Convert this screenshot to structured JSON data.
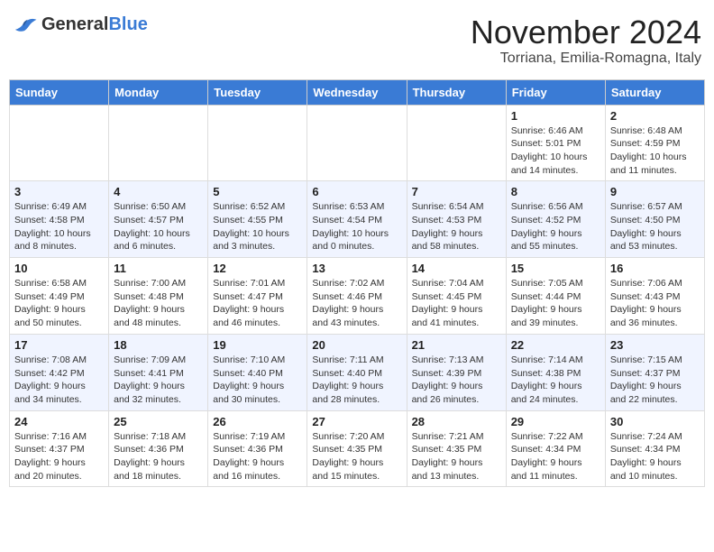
{
  "header": {
    "logo_general": "General",
    "logo_blue": "Blue",
    "month": "November 2024",
    "location": "Torriana, Emilia-Romagna, Italy"
  },
  "days_of_week": [
    "Sunday",
    "Monday",
    "Tuesday",
    "Wednesday",
    "Thursday",
    "Friday",
    "Saturday"
  ],
  "weeks": [
    {
      "alt": false,
      "days": [
        {
          "date": "",
          "info": ""
        },
        {
          "date": "",
          "info": ""
        },
        {
          "date": "",
          "info": ""
        },
        {
          "date": "",
          "info": ""
        },
        {
          "date": "",
          "info": ""
        },
        {
          "date": "1",
          "info": "Sunrise: 6:46 AM\nSunset: 5:01 PM\nDaylight: 10 hours and 14 minutes."
        },
        {
          "date": "2",
          "info": "Sunrise: 6:48 AM\nSunset: 4:59 PM\nDaylight: 10 hours and 11 minutes."
        }
      ]
    },
    {
      "alt": true,
      "days": [
        {
          "date": "3",
          "info": "Sunrise: 6:49 AM\nSunset: 4:58 PM\nDaylight: 10 hours and 8 minutes."
        },
        {
          "date": "4",
          "info": "Sunrise: 6:50 AM\nSunset: 4:57 PM\nDaylight: 10 hours and 6 minutes."
        },
        {
          "date": "5",
          "info": "Sunrise: 6:52 AM\nSunset: 4:55 PM\nDaylight: 10 hours and 3 minutes."
        },
        {
          "date": "6",
          "info": "Sunrise: 6:53 AM\nSunset: 4:54 PM\nDaylight: 10 hours and 0 minutes."
        },
        {
          "date": "7",
          "info": "Sunrise: 6:54 AM\nSunset: 4:53 PM\nDaylight: 9 hours and 58 minutes."
        },
        {
          "date": "8",
          "info": "Sunrise: 6:56 AM\nSunset: 4:52 PM\nDaylight: 9 hours and 55 minutes."
        },
        {
          "date": "9",
          "info": "Sunrise: 6:57 AM\nSunset: 4:50 PM\nDaylight: 9 hours and 53 minutes."
        }
      ]
    },
    {
      "alt": false,
      "days": [
        {
          "date": "10",
          "info": "Sunrise: 6:58 AM\nSunset: 4:49 PM\nDaylight: 9 hours and 50 minutes."
        },
        {
          "date": "11",
          "info": "Sunrise: 7:00 AM\nSunset: 4:48 PM\nDaylight: 9 hours and 48 minutes."
        },
        {
          "date": "12",
          "info": "Sunrise: 7:01 AM\nSunset: 4:47 PM\nDaylight: 9 hours and 46 minutes."
        },
        {
          "date": "13",
          "info": "Sunrise: 7:02 AM\nSunset: 4:46 PM\nDaylight: 9 hours and 43 minutes."
        },
        {
          "date": "14",
          "info": "Sunrise: 7:04 AM\nSunset: 4:45 PM\nDaylight: 9 hours and 41 minutes."
        },
        {
          "date": "15",
          "info": "Sunrise: 7:05 AM\nSunset: 4:44 PM\nDaylight: 9 hours and 39 minutes."
        },
        {
          "date": "16",
          "info": "Sunrise: 7:06 AM\nSunset: 4:43 PM\nDaylight: 9 hours and 36 minutes."
        }
      ]
    },
    {
      "alt": true,
      "days": [
        {
          "date": "17",
          "info": "Sunrise: 7:08 AM\nSunset: 4:42 PM\nDaylight: 9 hours and 34 minutes."
        },
        {
          "date": "18",
          "info": "Sunrise: 7:09 AM\nSunset: 4:41 PM\nDaylight: 9 hours and 32 minutes."
        },
        {
          "date": "19",
          "info": "Sunrise: 7:10 AM\nSunset: 4:40 PM\nDaylight: 9 hours and 30 minutes."
        },
        {
          "date": "20",
          "info": "Sunrise: 7:11 AM\nSunset: 4:40 PM\nDaylight: 9 hours and 28 minutes."
        },
        {
          "date": "21",
          "info": "Sunrise: 7:13 AM\nSunset: 4:39 PM\nDaylight: 9 hours and 26 minutes."
        },
        {
          "date": "22",
          "info": "Sunrise: 7:14 AM\nSunset: 4:38 PM\nDaylight: 9 hours and 24 minutes."
        },
        {
          "date": "23",
          "info": "Sunrise: 7:15 AM\nSunset: 4:37 PM\nDaylight: 9 hours and 22 minutes."
        }
      ]
    },
    {
      "alt": false,
      "days": [
        {
          "date": "24",
          "info": "Sunrise: 7:16 AM\nSunset: 4:37 PM\nDaylight: 9 hours and 20 minutes."
        },
        {
          "date": "25",
          "info": "Sunrise: 7:18 AM\nSunset: 4:36 PM\nDaylight: 9 hours and 18 minutes."
        },
        {
          "date": "26",
          "info": "Sunrise: 7:19 AM\nSunset: 4:36 PM\nDaylight: 9 hours and 16 minutes."
        },
        {
          "date": "27",
          "info": "Sunrise: 7:20 AM\nSunset: 4:35 PM\nDaylight: 9 hours and 15 minutes."
        },
        {
          "date": "28",
          "info": "Sunrise: 7:21 AM\nSunset: 4:35 PM\nDaylight: 9 hours and 13 minutes."
        },
        {
          "date": "29",
          "info": "Sunrise: 7:22 AM\nSunset: 4:34 PM\nDaylight: 9 hours and 11 minutes."
        },
        {
          "date": "30",
          "info": "Sunrise: 7:24 AM\nSunset: 4:34 PM\nDaylight: 9 hours and 10 minutes."
        }
      ]
    }
  ]
}
